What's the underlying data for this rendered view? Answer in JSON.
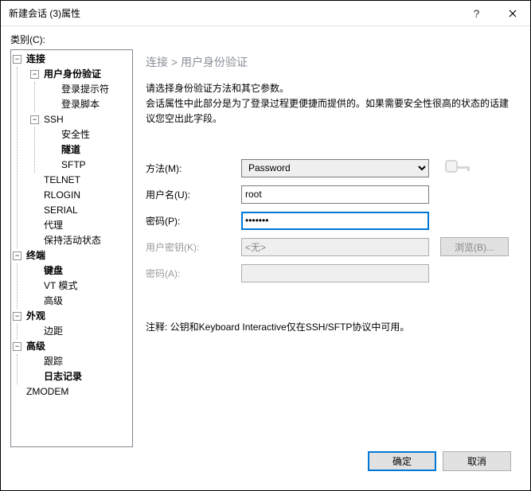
{
  "window": {
    "title": "新建会话 (3)属性"
  },
  "category_label": "类别(C):",
  "tree": {
    "connection": "连接",
    "auth": "用户身份验证",
    "login_prompt": "登录提示符",
    "login_script": "登录脚本",
    "ssh": "SSH",
    "security": "安全性",
    "tunnel": "隧道",
    "sftp": "SFTP",
    "telnet": "TELNET",
    "rlogin": "RLOGIN",
    "serial": "SERIAL",
    "proxy": "代理",
    "keepalive": "保持活动状态",
    "terminal": "终端",
    "keyboard": "键盘",
    "vt": "VT 模式",
    "advanced1": "高级",
    "appearance": "外观",
    "margin": "边距",
    "advanced2": "高级",
    "trace": "跟踪",
    "logging": "日志记录",
    "zmodem": "ZMODEM"
  },
  "panel": {
    "breadcrumb": "连接  >  用户身份验证",
    "desc1": "请选择身份验证方法和其它参数。",
    "desc2": "会话属性中此部分是为了登录过程更便捷而提供的。如果需要安全性很高的状态的话建议您空出此字段。",
    "method_label": "方法(M):",
    "method_value": "Password",
    "username_label": "用户名(U):",
    "username_value": "root",
    "password_label": "密码(P):",
    "password_value": "•••••••",
    "userkey_label": "用户密钥(K):",
    "userkey_value": "<无>",
    "browse_label": "浏览(B)...",
    "password2_label": "密码(A):",
    "note": "注释: 公钥和Keyboard Interactive仅在SSH/SFTP协议中可用。"
  },
  "buttons": {
    "ok": "确定",
    "cancel": "取消"
  }
}
